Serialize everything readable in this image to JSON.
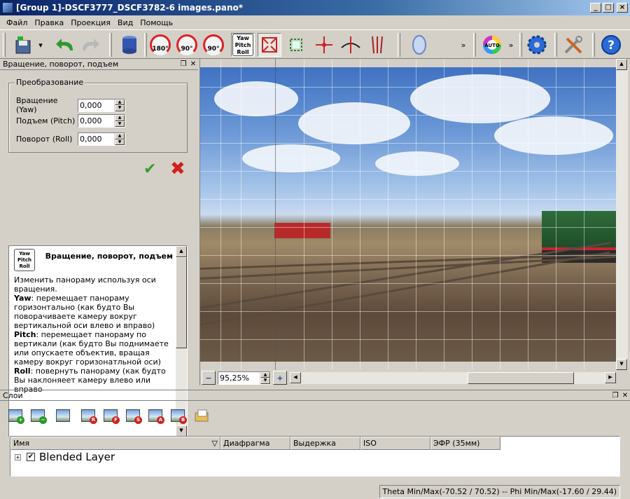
{
  "window": {
    "title": "[Group 1]-DSCF3777_DSCF3782-6 images.pano*"
  },
  "menu": [
    "Файл",
    "Правка",
    "Проекция",
    "Вид",
    "Помощь"
  ],
  "toolbar": {
    "rot180": "180°",
    "rot90l": "90°",
    "rot90r": "90°",
    "ypr": [
      "Yaw",
      "Pitch",
      "Roll"
    ],
    "auto": "AUTO",
    "more": "»"
  },
  "panel": {
    "title": "Вращение, поворот, подъем",
    "group_title": "Преобразование",
    "fields": [
      {
        "label": "Вращение (Yaw)",
        "value": "0,000"
      },
      {
        "label": "Подъем (Pitch)",
        "value": "0,000"
      },
      {
        "label": "Поворот (Roll)",
        "value": "0,000"
      }
    ],
    "help_title": "Вращение, поворот, подъем",
    "help_icon": [
      "Yaw",
      "Pitch",
      "Roll"
    ],
    "help_intro": "Изменить панораму используя оси вращения.",
    "help_items": [
      {
        "key": "Yaw",
        "text": ": перемещает панораму горизонтально (как будто Вы поворачиваете камеру вокруг вертикальной оси влево и вправо)"
      },
      {
        "key": "Pitch",
        "text": ": перемещает панораму по вертикали (как будто Вы поднимаете или опускаете объектив, вращая камеру вокруг горизонатльной оси)"
      },
      {
        "key": "Roll",
        "text": ": повернуть панораму (как будто Вы наклоняеет камеру влево или вправо"
      }
    ]
  },
  "preview": {
    "zoom": "95,25%"
  },
  "layers": {
    "title": "Слои",
    "columns": [
      "Имя",
      "Диафрагма",
      "Выдержка",
      "ISO",
      "ЭФР (35мм)"
    ],
    "rows": [
      {
        "name": "Blended Layer",
        "checked": true
      }
    ],
    "tool_badges": [
      "+",
      "−",
      "",
      "R",
      "F",
      "S",
      "A",
      "B"
    ]
  },
  "status": {
    "text": "Theta Min/Max(-70.52 / 70.52)  --  Phi Min/Max(-17.60 / 29.44)"
  },
  "colors": {
    "accent_titlebar": "#0a246a",
    "chrome": "#d4d0c8",
    "ok": "#3c9a2b",
    "cancel": "#d02020"
  }
}
